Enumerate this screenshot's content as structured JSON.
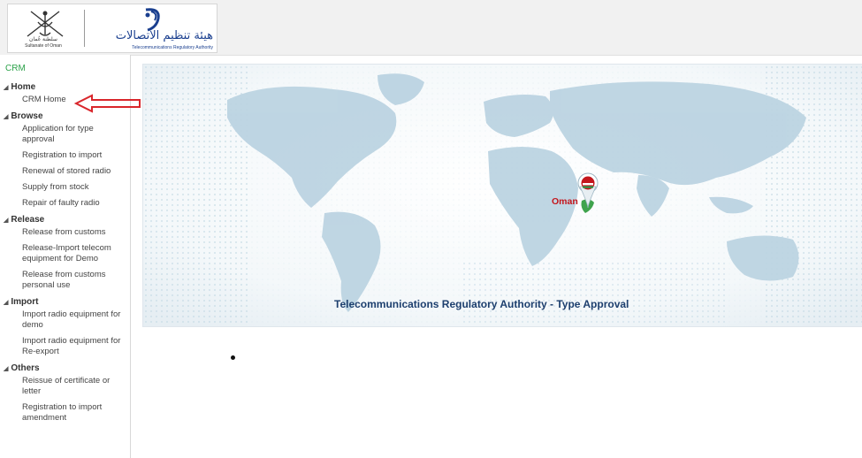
{
  "header": {
    "oman_label_ar": "سلطنة عُمان",
    "oman_label_en": "Sultanate of Oman",
    "tra_label_ar": "هيئة تنظيم الاتصالات",
    "tra_label_en": "Telecommunications Regulatory Authority"
  },
  "sidebar": {
    "crm_label": "CRM",
    "sections": [
      {
        "title": "Home",
        "items": [
          "CRM Home"
        ]
      },
      {
        "title": "Browse",
        "items": [
          "Application for type approval",
          "Registration to import",
          "Renewal of stored radio",
          "Supply from stock",
          "Repair of faulty radio"
        ]
      },
      {
        "title": "Release",
        "items": [
          "Release from customs",
          "Release-Import telecom equipment for Demo",
          "Release from customs personal use"
        ]
      },
      {
        "title": "Import",
        "items": [
          "Import radio equipment for demo",
          "Import radio equipment for Re-export"
        ]
      },
      {
        "title": "Others",
        "items": [
          "Reissue of certificate or letter",
          "Registration to import amendment"
        ]
      }
    ]
  },
  "banner": {
    "title": "Telecommunications Regulatory Authority - Type Approval",
    "marker_label": "Oman"
  },
  "colors": {
    "crm_green": "#2ca24a",
    "banner_title": "#1d3f6e",
    "annotation_arrow": "#d9262b",
    "oman_marker": "#c4161c"
  }
}
